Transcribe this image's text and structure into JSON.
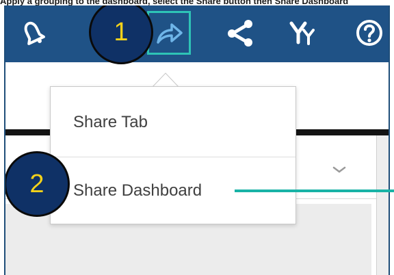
{
  "caption": "Apply a grouping to the dashboard, select the Share button then Share Dashboard",
  "toolbar": {
    "icons": [
      "bell-icon",
      "share-arrow-icon",
      "share-network-icon",
      "yy-icon",
      "help-icon"
    ]
  },
  "share_menu": {
    "items": [
      {
        "label": "Share Tab"
      },
      {
        "label": "Share Dashboard"
      }
    ]
  },
  "callouts": {
    "step1": "1",
    "step2": "2"
  },
  "colors": {
    "toolbar_bg": "#1f5286",
    "highlight": "#2ec4b6",
    "badge_bg": "#0f3166",
    "badge_text": "#f5d21a",
    "pointer_line": "#19b3a6"
  }
}
